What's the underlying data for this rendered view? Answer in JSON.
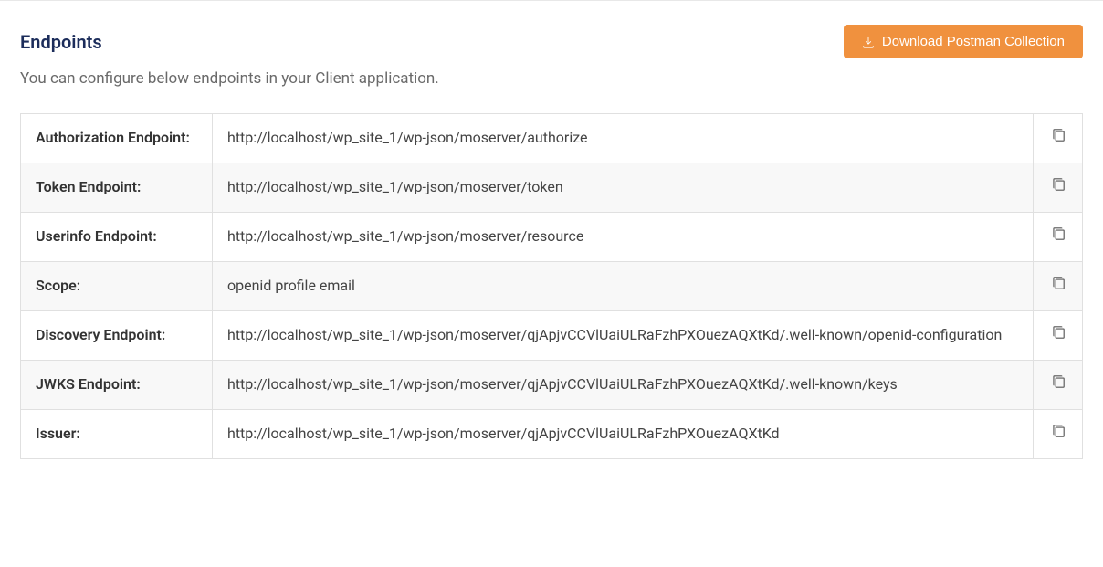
{
  "section": {
    "title": "Endpoints",
    "description": "You can configure below endpoints in your Client application.",
    "download_button": "Download Postman Collection"
  },
  "endpoints": [
    {
      "label": "Authorization Endpoint:",
      "value": "http://localhost/wp_site_1/wp-json/moserver/authorize"
    },
    {
      "label": "Token Endpoint:",
      "value": "http://localhost/wp_site_1/wp-json/moserver/token"
    },
    {
      "label": "Userinfo Endpoint:",
      "value": "http://localhost/wp_site_1/wp-json/moserver/resource"
    },
    {
      "label": "Scope:",
      "value": "openid profile email"
    },
    {
      "label": "Discovery Endpoint:",
      "value": "http://localhost/wp_site_1/wp-json/moserver/qjApjvCCVlUaiULRaFzhPXOuezAQXtKd/.well-known/openid-configuration"
    },
    {
      "label": "JWKS Endpoint:",
      "value": "http://localhost/wp_site_1/wp-json/moserver/qjApjvCCVlUaiULRaFzhPXOuezAQXtKd/.well-known/keys"
    },
    {
      "label": "Issuer:",
      "value": "http://localhost/wp_site_1/wp-json/moserver/qjApjvCCVlUaiULRaFzhPXOuezAQXtKd"
    }
  ]
}
